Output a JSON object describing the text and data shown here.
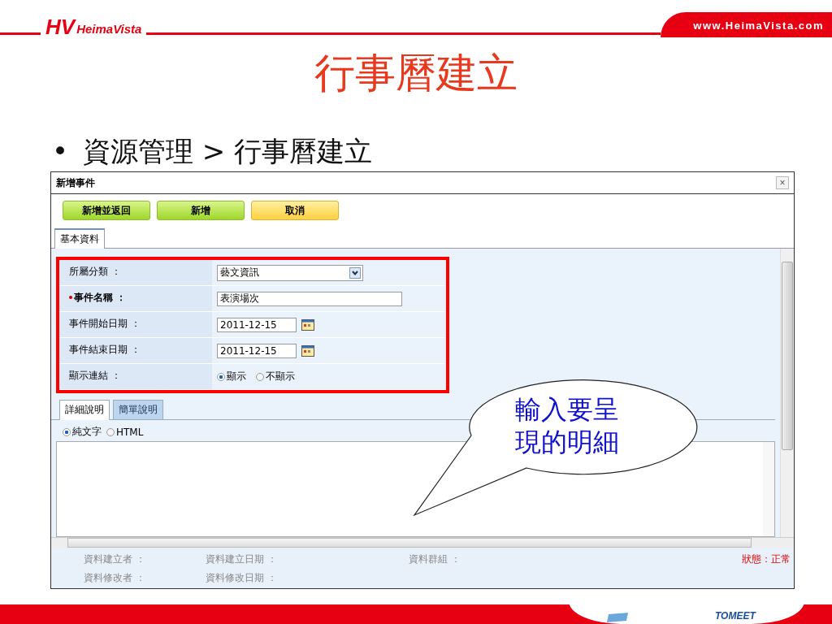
{
  "header": {
    "logo": {
      "mark": "HV",
      "name": "HeimaVista"
    },
    "website": "www.HeimaVista.com"
  },
  "slide_title": "行事曆建立",
  "bullet": {
    "mark": "•",
    "text": "資源管理 > 行事曆建立"
  },
  "window": {
    "title": "新增事件",
    "close": "×",
    "buttons": [
      {
        "label": "新增並返回",
        "kind": "confirm"
      },
      {
        "label": "新增",
        "kind": "confirm"
      },
      {
        "label": "取消",
        "kind": "cancel"
      }
    ],
    "tabs": [
      {
        "label": "基本資料",
        "selected": true
      }
    ],
    "form": [
      {
        "label": "所屬分類 ：",
        "required": false,
        "kind": "select",
        "value": "藝文資訊"
      },
      {
        "label": "事件名稱 ：",
        "required": true,
        "kind": "text",
        "value": "表演場次"
      },
      {
        "label": "事件開始日期 ：",
        "required": false,
        "kind": "date",
        "value": "2011-12-15"
      },
      {
        "label": "事件結束日期 ：",
        "required": false,
        "kind": "date",
        "value": "2011-12-15"
      },
      {
        "label": "顯示連結 ：",
        "required": false,
        "kind": "radio",
        "options": [
          {
            "label": "顯示",
            "selected": true
          },
          {
            "label": "不顯示",
            "selected": false
          }
        ]
      }
    ],
    "detail_tabs": [
      {
        "label": "詳細說明",
        "selected": true
      },
      {
        "label": "簡單說明",
        "selected": false
      }
    ],
    "format_options": [
      {
        "label": "純文字",
        "selected": true
      },
      {
        "label": "HTML",
        "selected": false
      }
    ],
    "footer": [
      {
        "text": "資料建立者 ：",
        "kind": "plain"
      },
      {
        "text": "資料建立日期 ：",
        "kind": "plain"
      },
      {
        "text": "資料群組 ：",
        "kind": "plain"
      },
      {
        "text": "狀態：正常",
        "kind": "status"
      },
      {
        "text": "資料修改者 ：",
        "kind": "plain"
      },
      {
        "text": "資料修改日期 ：",
        "kind": "plain"
      }
    ]
  },
  "callout": {
    "lines": [
      "輸入要呈",
      "現的明細"
    ]
  },
  "bottom_logo": {
    "name": "TOMEET"
  }
}
